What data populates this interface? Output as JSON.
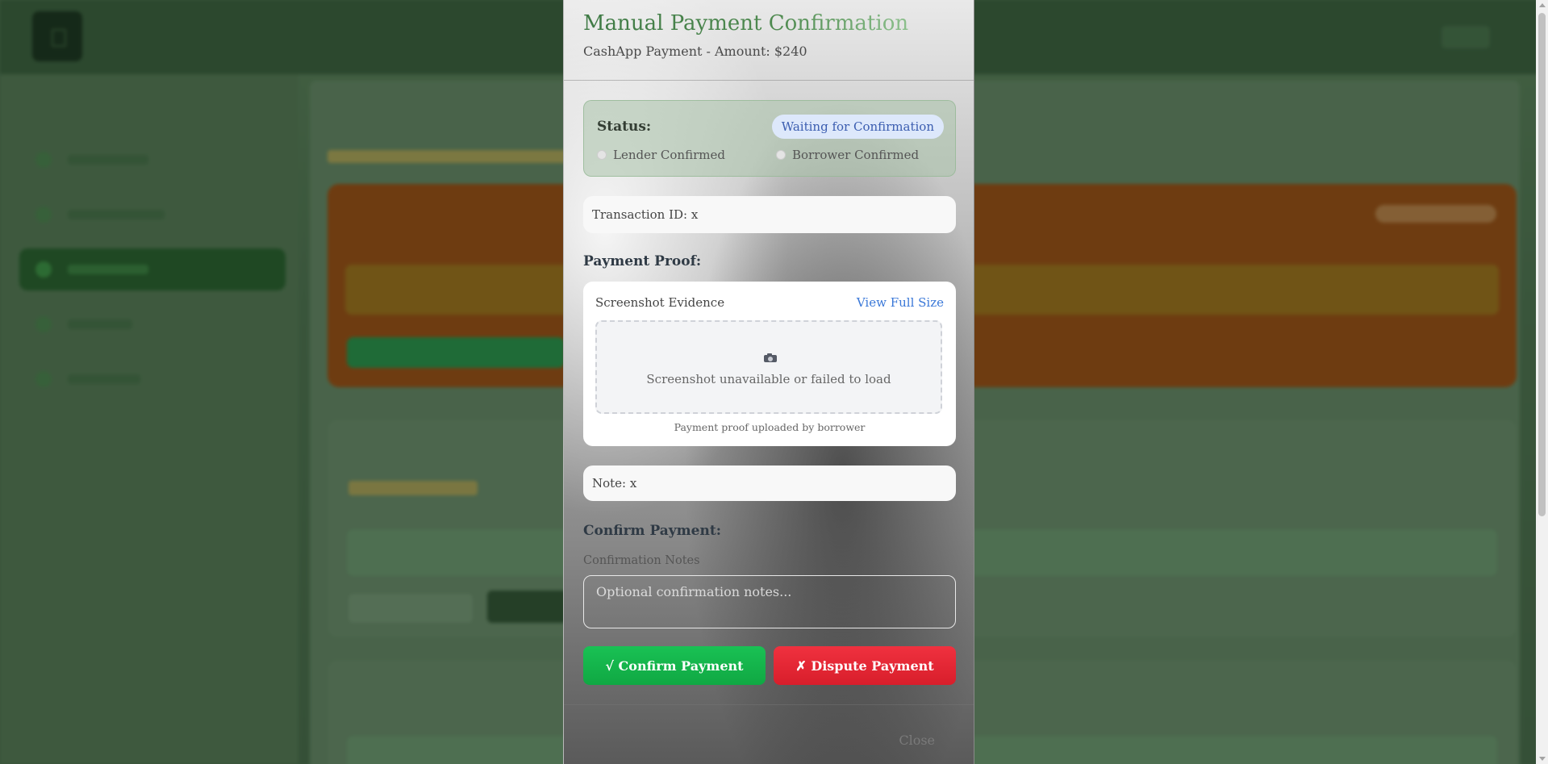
{
  "modal": {
    "title": "Manual Payment Confirmation",
    "subtitle": "CashApp Payment - Amount: $240",
    "status": {
      "label": "Status:",
      "badge": "Waiting for Confirmation",
      "lender_confirmed": "Lender Confirmed",
      "borrower_confirmed": "Borrower Confirmed"
    },
    "transaction_id": "Transaction ID: x",
    "payment_proof": {
      "section_label": "Payment Proof:",
      "card_title": "Screenshot Evidence",
      "view_full_size": "View Full Size",
      "icon": "camera-icon",
      "placeholder_text": "Screenshot unavailable or failed to load",
      "caption": "Payment proof uploaded by borrower"
    },
    "note": "Note: x",
    "confirm_section": {
      "label": "Confirm Payment:",
      "notes_label": "Confirmation Notes",
      "notes_placeholder": "Optional confirmation notes..."
    },
    "buttons": {
      "confirm": "√ Confirm Payment",
      "dispute": "✗ Dispute Payment",
      "close": "Close"
    }
  },
  "colors": {
    "confirm": "#10a843",
    "dispute": "#d81e2b",
    "status_badge_text": "#3b5db0",
    "link": "#3a78d8",
    "title_green": "#4f8a50"
  }
}
